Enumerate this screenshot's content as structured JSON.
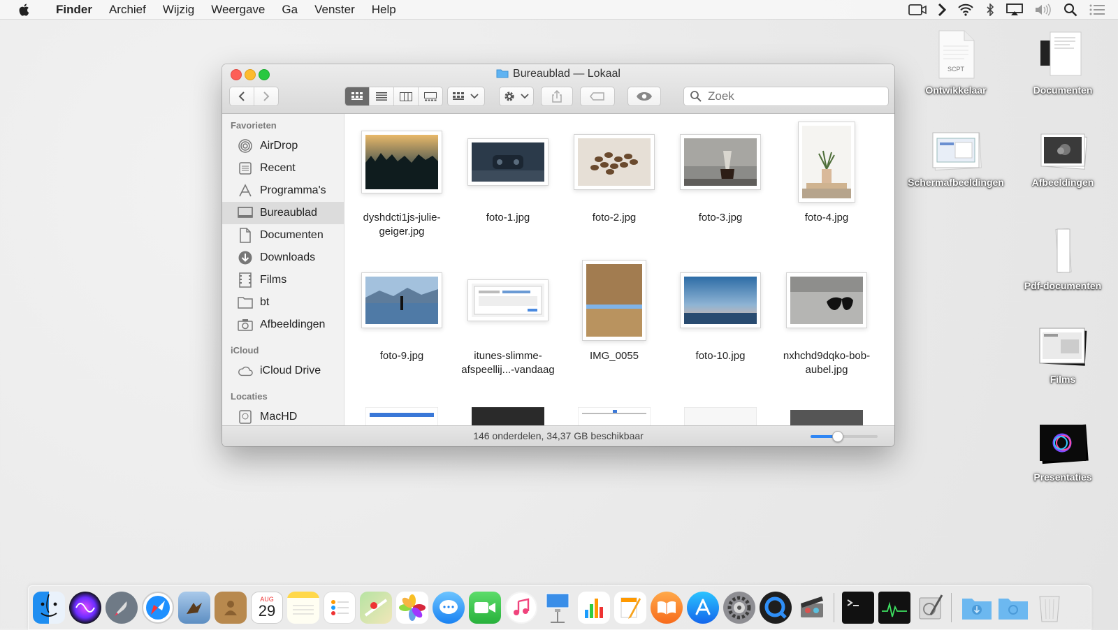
{
  "menubar": {
    "app_name": "Finder",
    "items": [
      "Archief",
      "Wijzig",
      "Weergave",
      "Ga",
      "Venster",
      "Help"
    ]
  },
  "desktop": {
    "icons": [
      {
        "label": "Ontwikkelaar",
        "badge": "SCPT"
      },
      {
        "label": "Documenten"
      },
      {
        "label": "Schermafbeeldingen"
      },
      {
        "label": "Afbeeldingen"
      },
      {
        "label": "Pdf-documenten"
      },
      {
        "label": "Films"
      },
      {
        "label": "Presentaties"
      }
    ]
  },
  "window": {
    "title": "Bureaublad — Lokaal",
    "search_placeholder": "Zoek",
    "status_text": "146 onderdelen, 34,37 GB beschikbaar",
    "icon_size_fraction": 0.4
  },
  "sidebar": {
    "sections": [
      {
        "header": "Favorieten",
        "items": [
          "AirDrop",
          "Recent",
          "Programma's",
          "Bureaublad",
          "Documenten",
          "Downloads",
          "Films",
          "bt",
          "Afbeeldingen"
        ]
      },
      {
        "header": "iCloud",
        "items": [
          "iCloud Drive"
        ]
      },
      {
        "header": "Locaties",
        "items": [
          "MacHD"
        ]
      }
    ],
    "selected": "Bureaublad"
  },
  "files": [
    {
      "line1": "dyshdcti1js-julie-",
      "line2": "geiger.jpg"
    },
    {
      "line1": "foto-1.jpg",
      "line2": ""
    },
    {
      "line1": "foto-2.jpg",
      "line2": ""
    },
    {
      "line1": "foto-3.jpg",
      "line2": ""
    },
    {
      "line1": "foto-4.jpg",
      "line2": ""
    },
    {
      "line1": "foto-9.jpg",
      "line2": ""
    },
    {
      "line1": "itunes-slimme-",
      "line2": "afspeellij...-vandaag"
    },
    {
      "line1": "IMG_0055",
      "line2": ""
    },
    {
      "line1": "foto-10.jpg",
      "line2": ""
    },
    {
      "line1": "nxhchd9dqko-bob-",
      "line2": "aubel.jpg"
    }
  ],
  "dock": {
    "calendar_month": "AUG",
    "calendar_day": "29"
  },
  "colors": {
    "accent": "#2f86f4",
    "close": "#fd5f57",
    "minimize": "#fdbb2e",
    "maximize": "#28c840"
  }
}
